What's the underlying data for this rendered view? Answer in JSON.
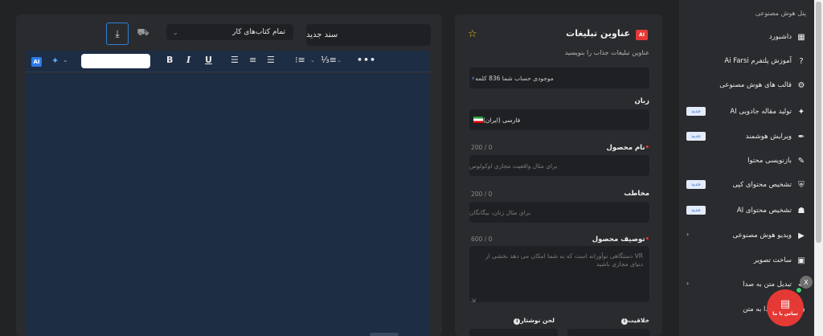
{
  "editor": {
    "doc_title": "سند جدید",
    "books_select": "تمام کتاب‌های کار",
    "toolbar": {
      "ai_label": "AI",
      "bold": "B",
      "italic": "I",
      "underline": "U",
      "more": "•••"
    }
  },
  "form": {
    "title": "عناوین تبلیغات",
    "ai_badge": "AI",
    "subtitle": "عناوین تبلیغات جذاب را بنویسید",
    "credit": "موجودی حساب شما 836 کلمه",
    "language_label": "زبان",
    "language_value": "فارسی (ایران)",
    "product_name_label": "نام محصول",
    "product_name_counter": "200 / 0",
    "product_name_placeholder": "برای مثال واقعیت مجازی اوکولوس",
    "audience_label": "مخاطب",
    "audience_counter": "200 / 0",
    "audience_placeholder": "برای مثال زنان، بیگانگان",
    "description_label": "توصیف محصول",
    "description_counter": "600 / 0",
    "description_placeholder": "VR دستگاهی نوآورانه است که به شما امکان می دهد بخشی از دنیای مجازی باشید",
    "creativity_label": "خلاقیت",
    "tone_label": "لحن نوشتار"
  },
  "sidebar": {
    "header": "پنل هوش مصنوعی",
    "items": [
      {
        "label": "داشبورد",
        "icon": "dashboard-icon",
        "badge": "",
        "chevron": false
      },
      {
        "label": "آموزش پلتفرم Ai Farsi",
        "icon": "help-icon",
        "badge": "",
        "chevron": false
      },
      {
        "label": "قالب های هوش مصنوعی",
        "icon": "chip-icon",
        "badge": "",
        "chevron": false
      },
      {
        "label": "تولید مقاله جادویی AI",
        "icon": "sparkle-icon",
        "badge": "جدید",
        "chevron": false
      },
      {
        "label": "ویرایش هوشمند",
        "icon": "feather-icon",
        "badge": "جدید",
        "chevron": false
      },
      {
        "label": "بازنویسی محتوا",
        "icon": "pencil-icon",
        "badge": "",
        "chevron": false
      },
      {
        "label": "تشخیص محتوای کپی",
        "icon": "shield-icon",
        "badge": "جدید",
        "chevron": false
      },
      {
        "label": "تشخیص محتوای AI",
        "icon": "robot-icon",
        "badge": "جدید",
        "chevron": false
      },
      {
        "label": "ویدیو هوش مصنوعی",
        "icon": "video-icon",
        "badge": "",
        "chevron": true
      },
      {
        "label": "ساخت تصویر",
        "icon": "image-icon",
        "badge": "",
        "chevron": false
      },
      {
        "label": "تبدیل متن به صدا",
        "icon": "speaker-icon",
        "badge": "",
        "chevron": true
      },
      {
        "label": "تبدیل صدا به متن",
        "icon": "mic-icon",
        "badge": "",
        "chevron": false
      }
    ]
  },
  "chat": {
    "close": "X",
    "label": "تماس با ما"
  },
  "colors": {
    "accent_blue": "#2d7be6",
    "brand_red": "#e53935",
    "editor_bg": "#1d2d44"
  }
}
